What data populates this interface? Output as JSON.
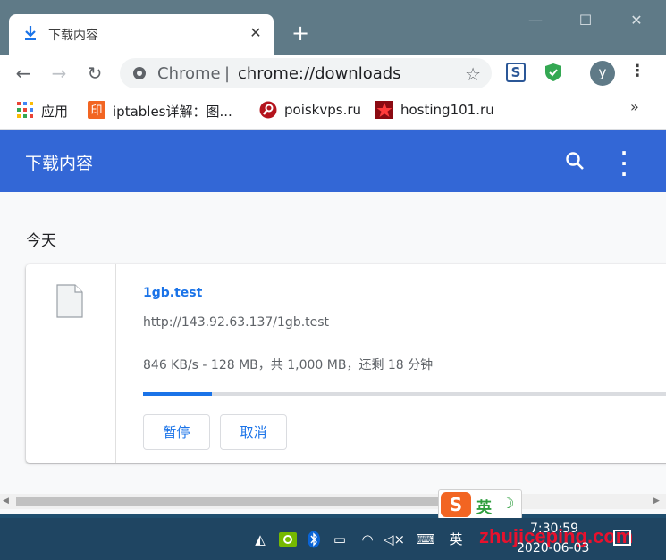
{
  "window": {
    "tab_title": "下载内容",
    "minimize": "—",
    "maximize": "☐",
    "close": "✕"
  },
  "toolbar": {
    "back": "←",
    "forward": "→",
    "reload": "↻",
    "chip": "Chrome",
    "separator": "|",
    "url": "chrome://downloads",
    "avatar_letter": "y",
    "menu": "⋮"
  },
  "bookmarks": [
    {
      "label": "应用",
      "icon": "apps-grid-icon"
    },
    {
      "label": "iptables详解：图...",
      "icon": "yinxiang-icon"
    },
    {
      "label": "poiskvps.ru",
      "icon": "poiskvps-icon"
    },
    {
      "label": "hosting101.ru",
      "icon": "hosting101-icon"
    }
  ],
  "bookmarks_more": "»",
  "downloads": {
    "title": "下载内容",
    "date_group": "今天",
    "item": {
      "file_name": "1gb.test",
      "url": "http://143.92.63.137/1gb.test",
      "status": "846 KB/s - 128 MB，共 1,000 MB，还剩 18 分钟",
      "progress": 0.128,
      "pause_label": "暂停",
      "cancel_label": "取消"
    }
  },
  "ime": {
    "logo": "S",
    "mode": "英",
    "moon": "☽"
  },
  "taskbar": {
    "ime_indicator": "英",
    "time": "7:30:59",
    "date": "2020-06-03",
    "watermark": "zhujiceping.com"
  },
  "colors": {
    "accent": "#3367d6",
    "link": "#1a73e8",
    "titlebar": "#5f7a87"
  }
}
